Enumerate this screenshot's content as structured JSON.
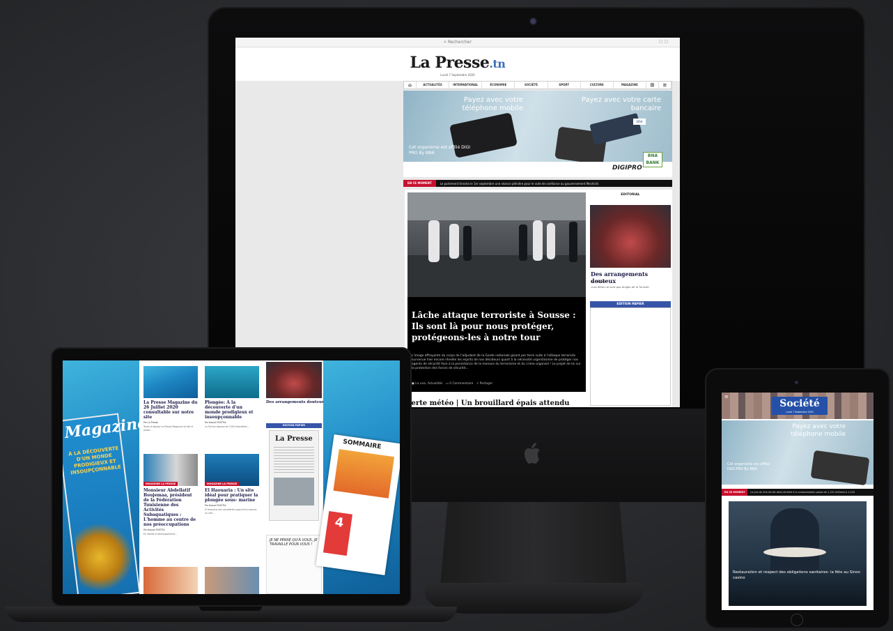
{
  "site": {
    "logo_main": "La Presse",
    "logo_tld": ".tn",
    "date": "Lundi 7 Septembre 2020",
    "search_label": "Rechercher"
  },
  "nav": {
    "items": [
      "ACTUALITÉS",
      "INTERNATIONAL",
      "ÉCONOMIE",
      "SOCIÉTÉ",
      "SPORT",
      "CULTURE",
      "MAGAZINE"
    ]
  },
  "ad": {
    "left_text": "Payez avec votre téléphone mobile",
    "right_text": "Payez avec votre carte bancaire",
    "small_text": "Cet organisme est affilié DIGI PRO By BNA",
    "brand": "DIGIPRO",
    "bank": "BNA BANK",
    "visa": "VISA"
  },
  "ticker": {
    "label": "EN CE MOMENT",
    "text": "Le parlement tiendra le 1er septembre une séance plénière pour le vote de confiance au gouvernement Mechichi"
  },
  "hero": {
    "title": "Lâche attaque terroriste à Sousse : Ils sont là pour nous protéger, protégeons-les à notre tour",
    "description": "L'image effrayante du corps de l'adjudant de la Garde nationale gisant par terre suite à l'attaque terroriste survenue hier encore réveille les esprits de nos décideurs quant à la nécessité urgentissime de protéger nos agents de sécurité face à la persistance de la menace du terrorisme et du crime organisé ! Le projet de loi sur la protection des forces de sécurité...",
    "meta_author": "La une, Actualités",
    "meta_comments": "0 Commentaire",
    "meta_share": "Partager",
    "second_title": "Alerte météo | Un brouillard épais attendu cette nuit"
  },
  "sidebar": {
    "header": "EDITORIAL",
    "title": "Des arrangements douteux",
    "author": "LA PRESSE",
    "excerpt": "«Les élites ne sont pas dirigés de la Tunisie»",
    "papier": "EDITION PAPIER"
  },
  "macbook": {
    "magazine": "Magazine",
    "magazine_deck": "À LA DÉCOUVERTE D'UN MONDE PRODIGIEUX ET INSOUPÇONNABLE",
    "cards": [
      {
        "cat": "",
        "title": "La Presse Magazine du 26 Juillet 2020 consultable sur notre site",
        "author": "Par La Presse",
        "excerpt": "Toute la équipe La Presse Magazine se fait le plaisir..."
      },
      {
        "cat": "",
        "title": "Plongée: À la découverte d'un monde prodigieux et insoupçonnable",
        "author": "Par Kaouel M'ATTIA",
        "excerpt": "La Tunisie dispose de 1300 kilomètres..."
      },
      {
        "cat": "MAGAZINE LA PRESSE",
        "title": "Monsieur Abdellatif Boujemaa, président de la Fédération Tunisienne des Activités Subaquatiques : L'homme au centre de nos préoccupations",
        "author": "Par Kaouel M'ATTIA",
        "excerpt": "En réalité le développement..."
      },
      {
        "cat": "MAGAZINE LA PRESSE",
        "title": "El Haouaria : Un site idéal pour pratiquer la plongée sous- marine",
        "author": "Par Kaouel M'ATTIA",
        "excerpt": "El Haouaria est considérée aujourd'hui comme un site..."
      }
    ],
    "editorial": "Des arrangements douteux",
    "papier": "EDITION PAPIER",
    "paper_logo": "La Presse",
    "cartoon": "JE NE PENSE QU'À VOUS, JE TRAVAILLE POUR VOUS !",
    "sommaire": "SOMMAIRE",
    "sommaire_num": "4"
  },
  "ipad": {
    "section": "Société",
    "date": "Lundi 7 Septembre 2020",
    "ad_text": "Payez avec votre téléphone mobile",
    "ad_small": "Cet organisme est affilié DIGI PRO By BNA",
    "ticker_label": "EN CE MOMENT",
    "ticker_text": "Le prix du litre de lait demi-écrémé à la consommation passe de 1,120 millimes à 1,240",
    "hero_caption": "Restauration et respect des obligations sanitaires: la fête au Sinon casino"
  }
}
